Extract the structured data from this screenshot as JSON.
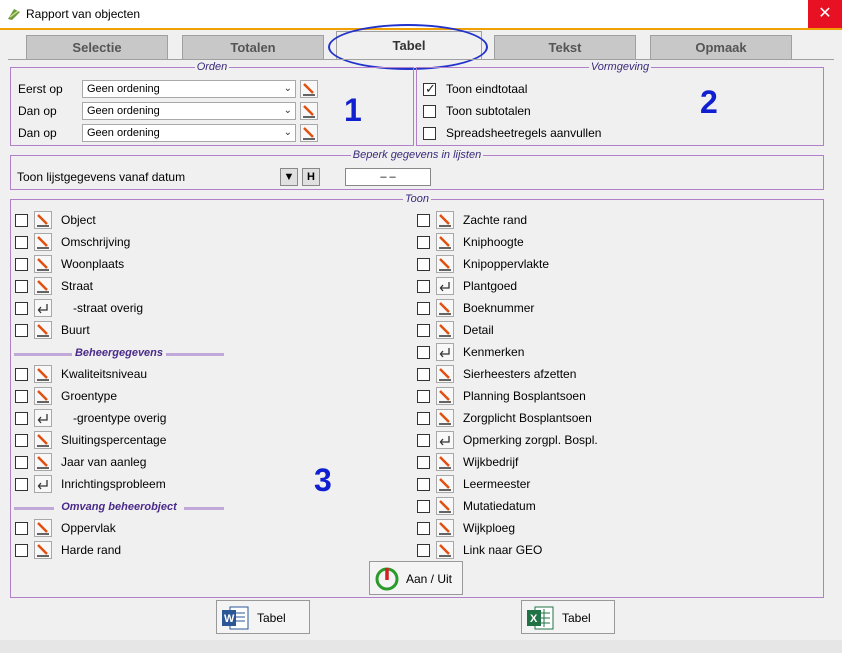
{
  "window": {
    "title": "Rapport van objecten",
    "close_glyph": "✕"
  },
  "tabs": [
    {
      "label": "Selectie",
      "active": false
    },
    {
      "label": "Totalen",
      "active": false
    },
    {
      "label": "Tabel",
      "active": true
    },
    {
      "label": "Tekst",
      "active": false
    },
    {
      "label": "Opmaak",
      "active": false
    }
  ],
  "orden": {
    "legend": "Orden",
    "rows": [
      {
        "label": "Eerst op",
        "value": "Geen ordening"
      },
      {
        "label": "Dan op",
        "value": "Geen ordening"
      },
      {
        "label": "Dan op",
        "value": "Geen ordening"
      }
    ],
    "marker": "1"
  },
  "vormgeving": {
    "legend": "Vormgeving",
    "options": [
      {
        "label": "Toon eindtotaal",
        "checked": true
      },
      {
        "label": "Toon subtotalen",
        "checked": false
      },
      {
        "label": "Spreadsheetregels aanvullen",
        "checked": false
      }
    ],
    "marker": "2"
  },
  "beperk": {
    "legend": "Beperk gegevens in lijsten",
    "label": "Toon lijstgegevens vanaf datum",
    "down_glyph": "▼",
    "h_label": "H",
    "date_value": "–   –"
  },
  "toon": {
    "legend": "Toon",
    "marker": "3",
    "section_beheer": "Beheergegevens",
    "section_omvang": "Omvang beheerobject",
    "left": [
      {
        "label": "Object",
        "icon": "pen-icon",
        "checked": false
      },
      {
        "label": "Omschrijving",
        "icon": "pen-icon",
        "checked": false
      },
      {
        "label": "Woonplaats",
        "icon": "pen-icon",
        "checked": false
      },
      {
        "label": "Straat",
        "icon": "pen-icon",
        "checked": false
      },
      {
        "label": "-straat overig",
        "icon": "return-icon",
        "checked": false
      },
      {
        "label": "Buurt",
        "icon": "pen-icon",
        "checked": false
      },
      {
        "label": "Kwaliteitsniveau",
        "icon": "pen-icon",
        "checked": false
      },
      {
        "label": "Groentype",
        "icon": "pen-icon",
        "checked": false
      },
      {
        "label": "-groentype overig",
        "icon": "return-icon",
        "checked": false
      },
      {
        "label": "Sluitingspercentage",
        "icon": "pen-icon",
        "checked": false
      },
      {
        "label": "Jaar van aanleg",
        "icon": "pen-icon",
        "checked": false
      },
      {
        "label": "Inrichtingsprobleem",
        "icon": "return-icon",
        "checked": false
      },
      {
        "label": "Oppervlak",
        "icon": "pen-icon",
        "checked": false
      },
      {
        "label": "Harde rand",
        "icon": "pen-icon",
        "checked": false
      }
    ],
    "right": [
      {
        "label": "Zachte rand",
        "icon": "pen-icon",
        "checked": false
      },
      {
        "label": "Kniphoogte",
        "icon": "pen-icon",
        "checked": false
      },
      {
        "label": "Knipoppervlakte",
        "icon": "pen-icon",
        "checked": false
      },
      {
        "label": "Plantgoed",
        "icon": "return-icon",
        "checked": false
      },
      {
        "label": "Boeknummer",
        "icon": "pen-icon",
        "checked": false
      },
      {
        "label": "Detail",
        "icon": "pen-icon",
        "checked": false
      },
      {
        "label": "Kenmerken",
        "icon": "return-icon",
        "checked": false
      },
      {
        "label": "Sierheesters afzetten",
        "icon": "pen-icon",
        "checked": false
      },
      {
        "label": "Planning Bosplantsoen",
        "icon": "pen-icon",
        "checked": false
      },
      {
        "label": "Zorgplicht Bosplantsoen",
        "icon": "pen-icon",
        "checked": false
      },
      {
        "label": "Opmerking zorgpl. Bospl.",
        "icon": "return-icon",
        "checked": false
      },
      {
        "label": "Wijkbedrijf",
        "icon": "pen-icon",
        "checked": false
      },
      {
        "label": "Leermeester",
        "icon": "pen-icon",
        "checked": false
      },
      {
        "label": "Mutatiedatum",
        "icon": "pen-icon",
        "checked": false
      },
      {
        "label": "Wijkploeg",
        "icon": "pen-icon",
        "checked": false
      },
      {
        "label": "Link naar GEO",
        "icon": "pen-icon",
        "checked": false
      }
    ],
    "toggle_label": "Aan / Uit"
  },
  "export": {
    "word_label": "Tabel",
    "excel_label": "Tabel"
  },
  "colors": {
    "accent": "#f0a000",
    "marker": "#1020d0",
    "pen": "#e05010",
    "legend_border": "#b080c8"
  }
}
